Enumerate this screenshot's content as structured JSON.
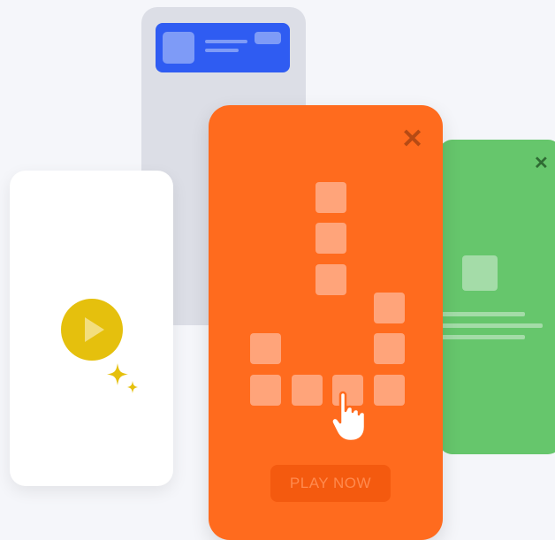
{
  "orange_card": {
    "close_symbol": "✕",
    "cta_label": "PLAY NOW",
    "color": "#ff6b1e"
  },
  "green_card": {
    "close_symbol": "✕",
    "color": "#66c66c"
  },
  "white_card": {
    "play_icon": "play-icon",
    "sparkle_icon": "sparkle-icon",
    "accent_color": "#e5c00d"
  },
  "gray_card": {
    "banner_color": "#2f5cf2"
  },
  "icons": [
    "close-icon",
    "play-icon",
    "sparkle-icon",
    "pointer-hand-icon"
  ]
}
